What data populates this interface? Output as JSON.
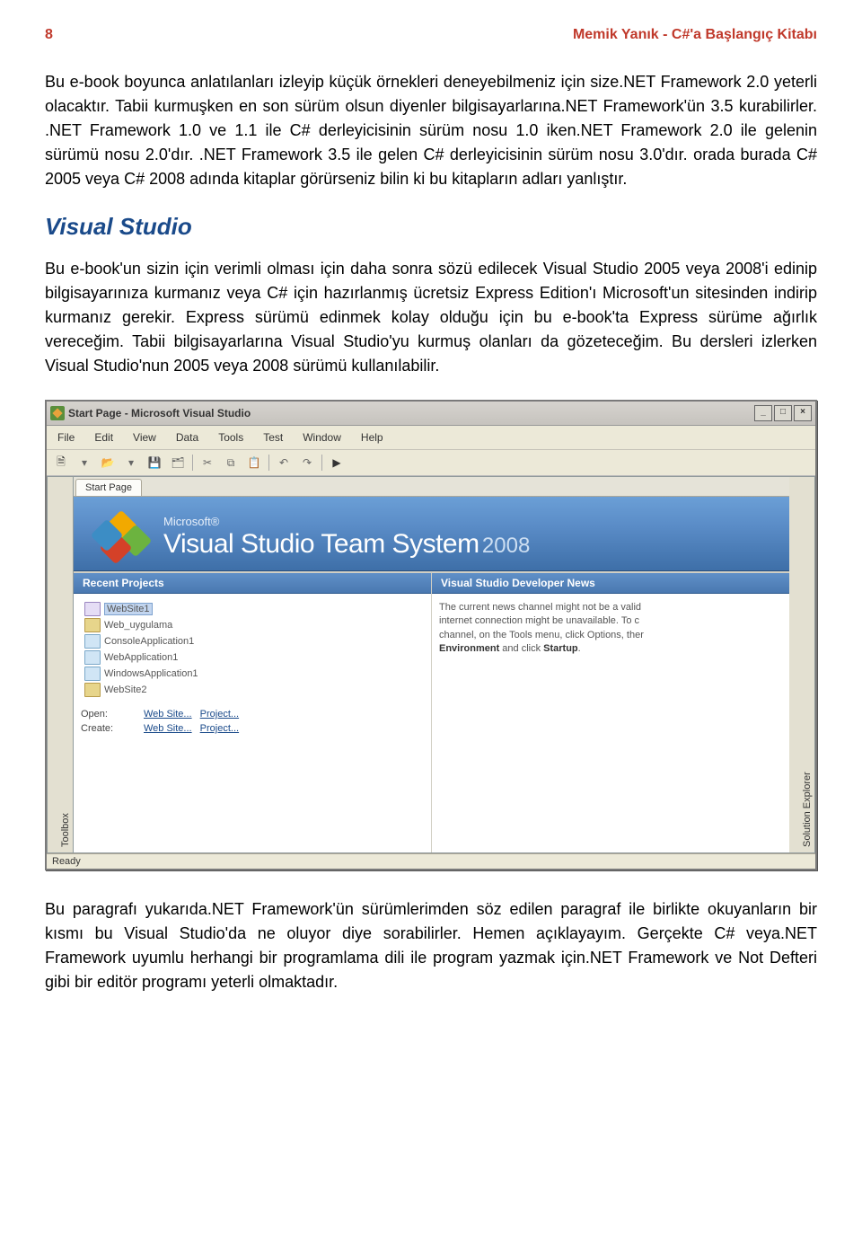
{
  "header": {
    "page_number": "8",
    "book_title": "Memik Yanık - C#'a Başlangıç Kitabı"
  },
  "para1": "Bu e-book boyunca anlatılanları izleyip küçük örnekleri deneyebilmeniz için size.NET Framework 2.0 yeterli olacaktır. Tabii kurmuşken en son sürüm olsun diyenler bilgisayarlarına.NET Framework'ün 3.5 kurabilirler. .NET Framework 1.0 ve 1.1 ile C# derleyicisinin sürüm nosu 1.0 iken.NET Framework 2.0 ile gelenin sürümü nosu 2.0'dır. .NET Framework 3.5 ile gelen C# derleyicisinin sürüm nosu 3.0'dır. orada burada C# 2005 veya C# 2008 adında kitaplar görürseniz bilin ki bu kitapların adları yanlıştır.",
  "section_title": "Visual Studio",
  "para2": "Bu e-book'un sizin için verimli olması için daha sonra sözü edilecek Visual Studio 2005 veya 2008'i edinip bilgisayarınıza kurmanız veya C# için hazırlanmış ücretsiz Express Edition'ı Microsoft'un sitesinden indirip kurmanız gerekir. Express sürümü edinmek kolay olduğu için bu e-book'ta Express sürüme ağırlık vereceğim. Tabii bilgisayarlarına Visual Studio'yu kurmuş olanları da gözeteceğim. Bu dersleri izlerken Visual Studio'nun 2005 veya 2008 sürümü kullanılabilir.",
  "vs": {
    "title": "Start Page - Microsoft Visual Studio",
    "menu": [
      "File",
      "Edit",
      "View",
      "Data",
      "Tools",
      "Test",
      "Window",
      "Help"
    ],
    "left_panel": "Toolbox",
    "right_panel": "Solution Explorer",
    "tab": "Start Page",
    "banner": {
      "ms": "Microsoft®",
      "product": "Visual Studio Team System",
      "year": "2008"
    },
    "recent_header": "Recent Projects",
    "recent_projects": [
      {
        "name": "WebSite1",
        "selected": true,
        "icon": "site"
      },
      {
        "name": "Web_uygulama",
        "icon": "folder"
      },
      {
        "name": "ConsoleApplication1",
        "icon": "cs"
      },
      {
        "name": "WebApplication1",
        "icon": "cs"
      },
      {
        "name": "WindowsApplication1",
        "icon": "cs"
      },
      {
        "name": "WebSite2",
        "icon": "folder"
      }
    ],
    "open_label": "Open:",
    "create_label": "Create:",
    "link_website": "Web Site...",
    "link_project": "Project...",
    "news_header": "Visual Studio Developer News",
    "news_line1": "The current news channel might not be a valid",
    "news_line2": "internet connection might be unavailable. To c",
    "news_line3": "channel, on the Tools menu, click Options, ther",
    "news_bold": "Environment",
    "news_line4": " and click ",
    "news_bold2": "Startup",
    "news_end": ".",
    "status": "Ready"
  },
  "para3": "Bu paragrafı yukarıda.NET Framework'ün sürümlerimden söz edilen paragraf ile birlikte okuyanların bir kısmı bu Visual Studio'da ne oluyor diye sorabilirler. Hemen açıklayayım. Gerçekte C# veya.NET Framework uyumlu herhangi bir programlama dili ile program yazmak için.NET Framework ve Not Defteri gibi bir editör programı yeterli olmaktadır."
}
